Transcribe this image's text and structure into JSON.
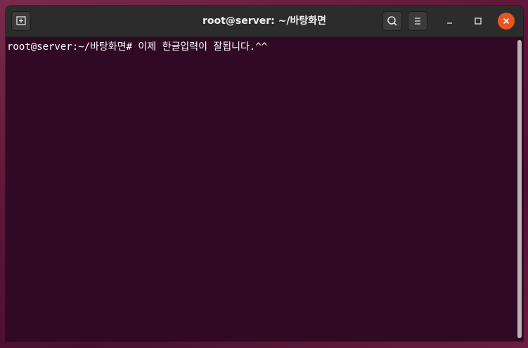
{
  "window": {
    "title": "root@server: ~/바탕화면"
  },
  "titlebar": {
    "new_tab_icon": "new-tab-icon",
    "search_icon": "search-icon",
    "menu_icon": "hamburger-menu-icon",
    "minimize_icon": "minimize-icon",
    "maximize_icon": "maximize-icon",
    "close_icon": "close-icon"
  },
  "terminal": {
    "prompt": "root@server:~/바탕화면#",
    "command": "이제 한글입력이 잘됩니다.^^"
  },
  "colors": {
    "terminal_bg": "#300a24",
    "titlebar_bg": "#2c2c2c",
    "close_accent": "#e95420",
    "text": "#ffffff"
  }
}
